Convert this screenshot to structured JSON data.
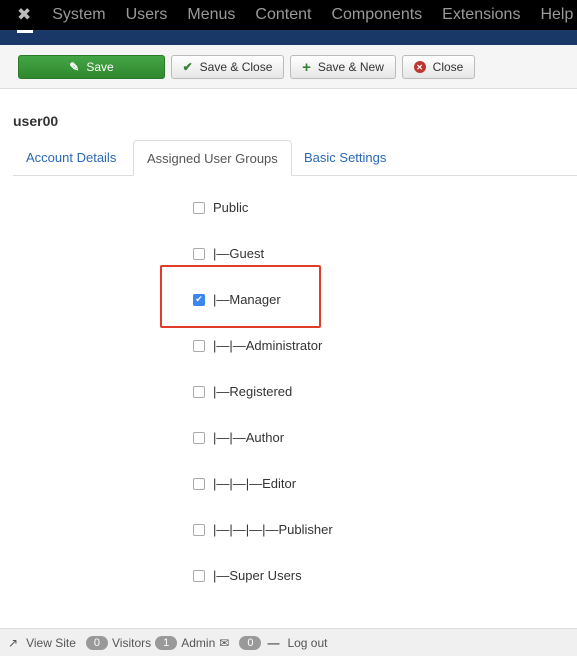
{
  "nav": {
    "items": [
      "System",
      "Users",
      "Menus",
      "Content",
      "Components",
      "Extensions",
      "Help"
    ]
  },
  "toolbar": {
    "save": "Save",
    "save_close": "Save & Close",
    "save_new": "Save & New",
    "close": "Close"
  },
  "username": "user00",
  "tabs": [
    "Account Details",
    "Assigned User Groups",
    "Basic Settings"
  ],
  "groups": [
    {
      "label": "Public",
      "checked": false
    },
    {
      "label": "|—Guest",
      "checked": false
    },
    {
      "label": "|—Manager",
      "checked": true
    },
    {
      "label": "|—|—Administrator",
      "checked": false
    },
    {
      "label": "|—Registered",
      "checked": false
    },
    {
      "label": "|—|—Author",
      "checked": false
    },
    {
      "label": "|—|—|—Editor",
      "checked": false
    },
    {
      "label": "|—|—|—|—Publisher",
      "checked": false
    },
    {
      "label": "|—Super Users",
      "checked": false
    }
  ],
  "footer": {
    "view_site": "View Site",
    "visitors_count": "0",
    "visitors": "Visitors",
    "admin_count": "1",
    "admin": "Admin",
    "messages_count": "0",
    "logout": "Log out"
  },
  "colors": {
    "highlight": "#e03c2c",
    "save_green": "#3a963a",
    "header_blue": "#1a3867"
  }
}
